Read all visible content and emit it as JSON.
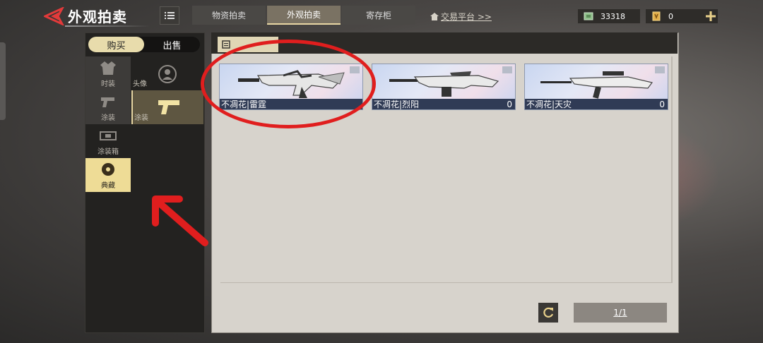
{
  "header": {
    "title": "外观拍卖",
    "tabs": [
      {
        "label": "物资拍卖",
        "active": false
      },
      {
        "label": "外观拍卖",
        "active": true
      },
      {
        "label": "寄存柜",
        "active": false
      }
    ],
    "trade_link": "交易平台 >>",
    "currency": [
      {
        "icon": "cash-icon",
        "value": "33318"
      },
      {
        "icon": "coupon-icon",
        "value": "0"
      }
    ]
  },
  "mode_toggle": {
    "buy": "购买",
    "sell": "出售",
    "active": "buy"
  },
  "categories": [
    {
      "label": "时装",
      "icon": "outfit-icon"
    },
    {
      "label": "涂装",
      "icon": "pistol-icon"
    },
    {
      "label": "涂装箱",
      "icon": "crate-icon"
    },
    {
      "label": "典藏",
      "icon": "collection-icon",
      "active": true
    }
  ],
  "subcategories": [
    {
      "label": "头像",
      "icon": "avatar-icon"
    },
    {
      "label": "涂装",
      "icon": "pistol-icon",
      "active": true
    }
  ],
  "items": [
    {
      "name": "不凋花|雷霆",
      "count": ""
    },
    {
      "name": "不凋花|烈阳",
      "count": "0"
    },
    {
      "name": "不凋花|天灾",
      "count": "0"
    }
  ],
  "pagination": {
    "label": "1/1"
  },
  "colors": {
    "accent_gold": "#e8dcac",
    "annotation_red": "#e01e1e",
    "card_name_bg": "#303b55"
  }
}
